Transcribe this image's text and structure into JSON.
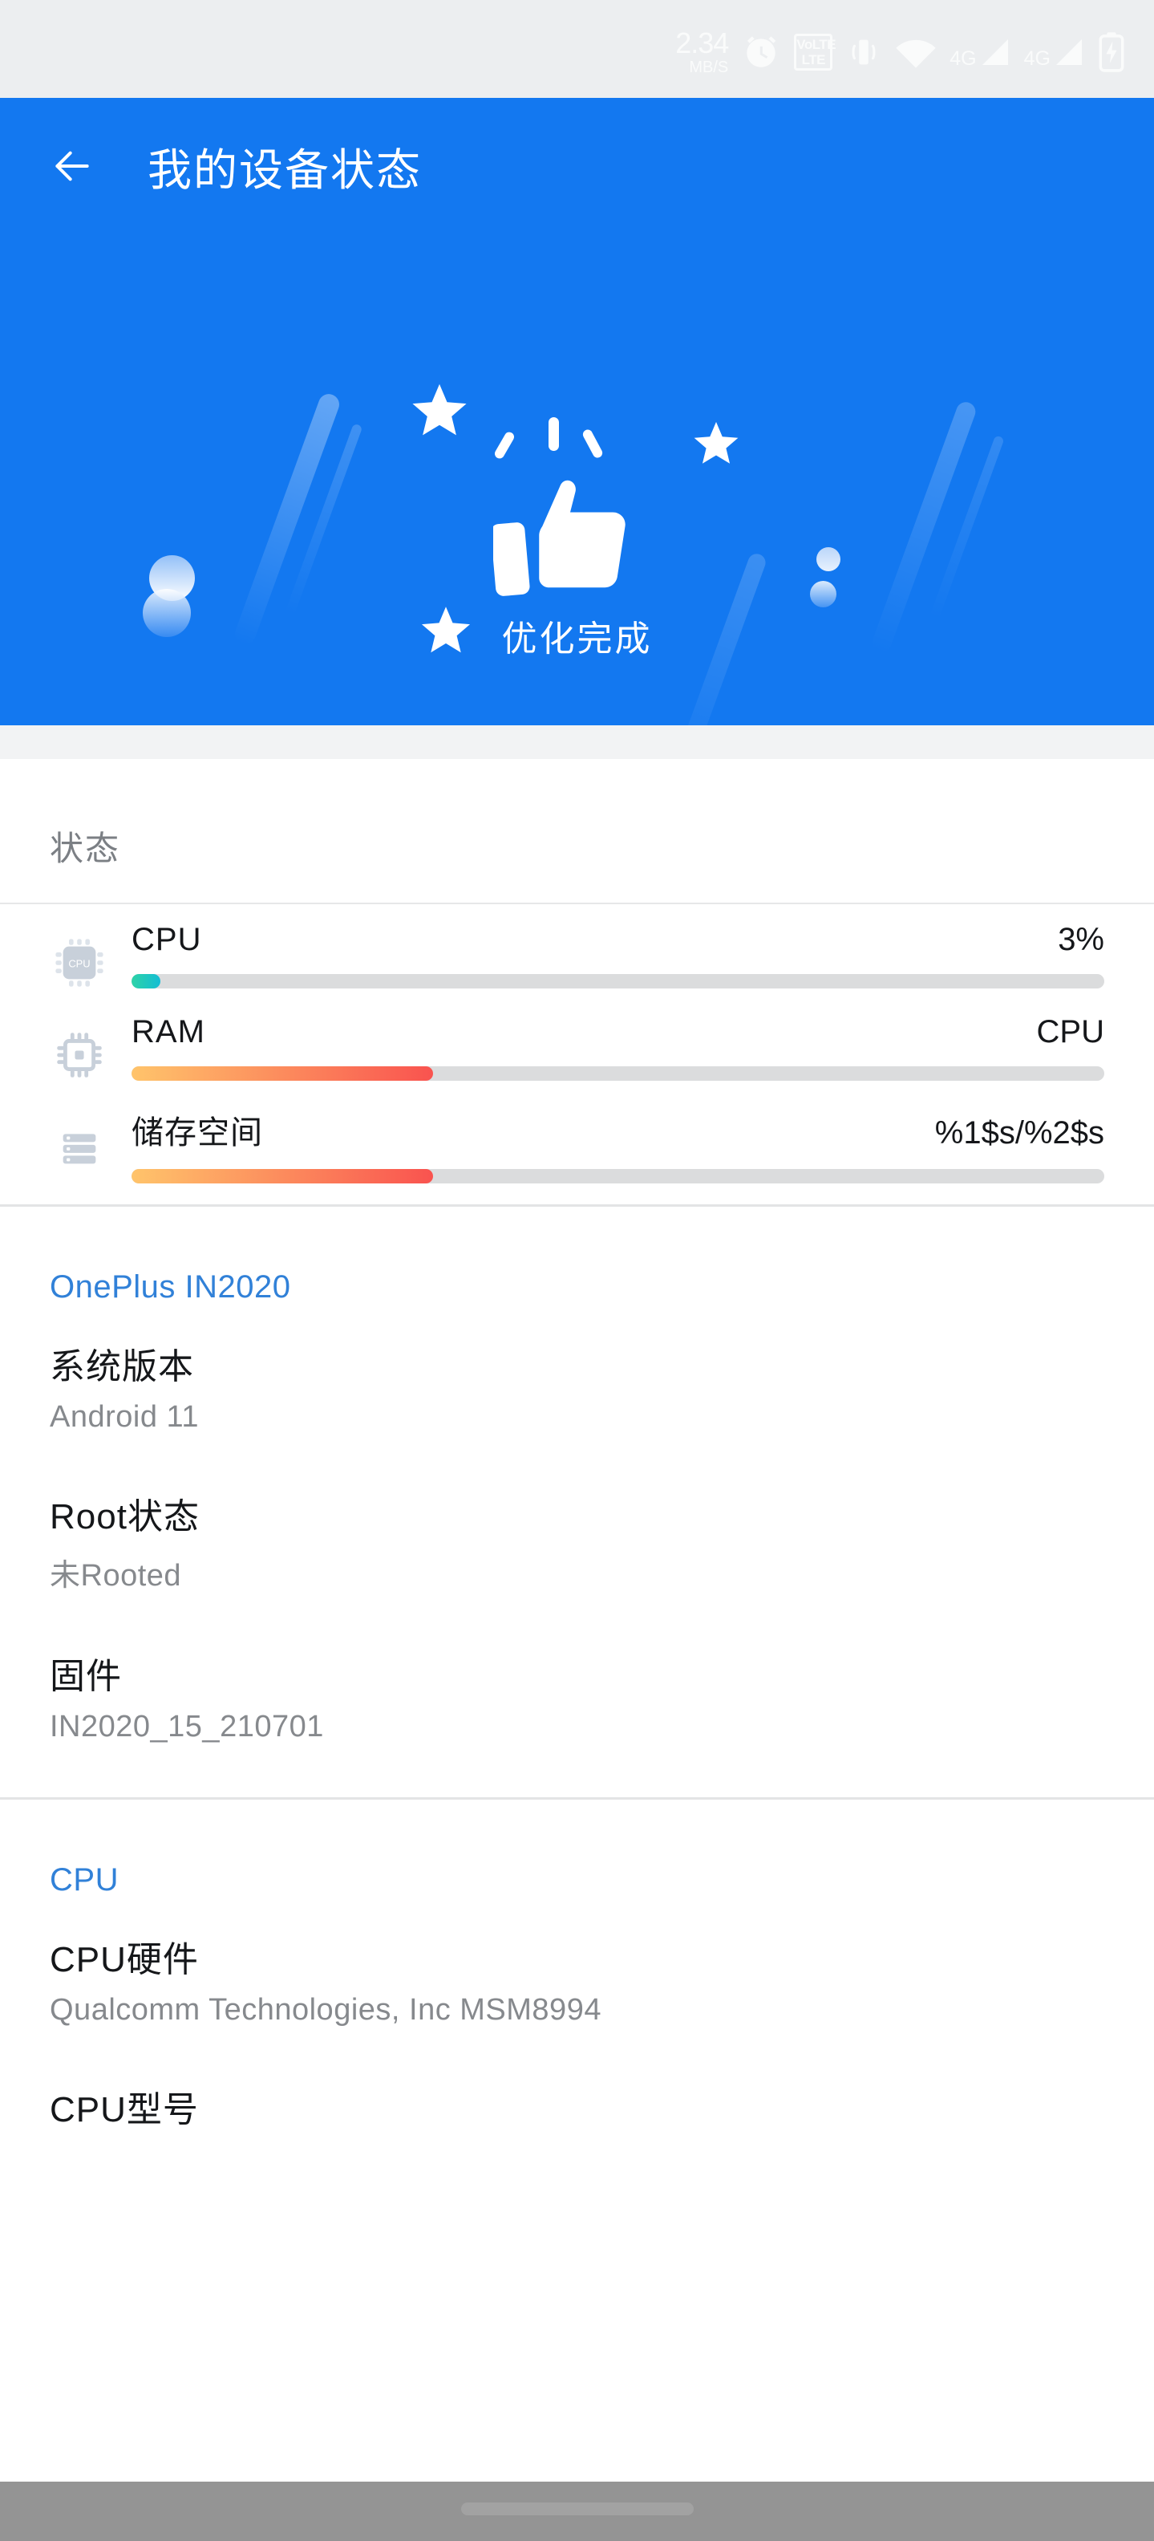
{
  "statusbar": {
    "network_speed_value": "2.34",
    "network_speed_unit": "MB/S",
    "icons": [
      "alarm-icon",
      "volte-icon",
      "vibrate-icon",
      "wifi-icon",
      "signal-4g-sim1-icon",
      "signal-4g-sim2-icon",
      "battery-charging-icon"
    ],
    "volte_line1": "VoLTE",
    "volte_line2": "LTE",
    "sim1_label": "4G",
    "sim2_label": "4G"
  },
  "header": {
    "back_icon": "back-arrow-icon",
    "title": "我的设备状态",
    "caption": "优化完成",
    "illustration": "thumbs-up-icon",
    "accent": "#1378f0"
  },
  "status_section": {
    "title": "状态",
    "rows": [
      {
        "icon": "cpu-chip-icon",
        "label": "CPU",
        "value": "3%",
        "percent": 3,
        "fill_from": "#2ed3a7",
        "fill_to": "#13bdd4"
      },
      {
        "icon": "ram-chip-icon",
        "label": "RAM",
        "value": "CPU",
        "percent": 31,
        "fill_from": "#ffc46b",
        "fill_to": "#f9534f"
      },
      {
        "icon": "storage-stack-icon",
        "label": "储存空间",
        "value": "%1$s/%2$s",
        "percent": 31,
        "fill_from": "#ffc46b",
        "fill_to": "#f9534f"
      }
    ]
  },
  "device_section": {
    "title": "OnePlus IN2020",
    "title_color": "#3181d8",
    "items": [
      {
        "label": "系统版本",
        "value": "Android 11"
      },
      {
        "label": "Root状态",
        "value": "未Rooted"
      },
      {
        "label": "固件",
        "value": "IN2020_15_210701"
      }
    ]
  },
  "cpu_section": {
    "title": "CPU",
    "title_color": "#3181d8",
    "items": [
      {
        "label": "CPU硬件",
        "value": "Qualcomm Technologies, Inc MSM8994"
      },
      {
        "label": "CPU型号",
        "value": ""
      }
    ]
  },
  "navbar": {
    "home_pill": "home-indicator"
  }
}
